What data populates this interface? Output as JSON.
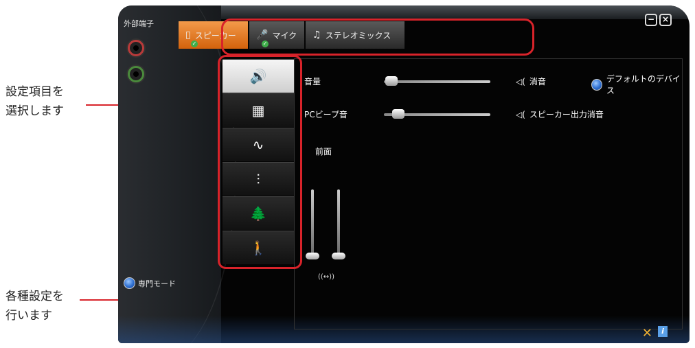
{
  "callouts": {
    "select_line1": "設定項目を",
    "select_line2": "選択します",
    "settings_line1": "各種設定を",
    "settings_line2": "行います"
  },
  "window": {
    "external_port_title": "外部端子",
    "expert_mode_label": "専門モード",
    "minimize_symbol": "−",
    "close_symbol": "×"
  },
  "tabs": [
    {
      "label": "スピーカー",
      "icon": "speaker-icon",
      "active": true,
      "has_check": true
    },
    {
      "label": "マイク",
      "icon": "microphone-icon",
      "active": false,
      "has_check": true
    },
    {
      "label": "ステレオミックス",
      "icon": "music-note-icon",
      "active": false,
      "has_check": false
    }
  ],
  "categories": [
    {
      "name": "volume-icon",
      "glyph": "🔊"
    },
    {
      "name": "speaker-config-icon",
      "glyph": "▦"
    },
    {
      "name": "waveform-icon",
      "glyph": "∿"
    },
    {
      "name": "equalizer-icon",
      "glyph": "⫶"
    },
    {
      "name": "environment-icon",
      "glyph": "🌲"
    },
    {
      "name": "room-correction-icon",
      "glyph": "🚶"
    }
  ],
  "main": {
    "volume_label": "音量",
    "volume_level": 0.04,
    "mute_label": "消音",
    "default_device_label": "デフォルトのデバイス",
    "pc_beep_label": "PCビープ音",
    "pc_beep_level": 0.1,
    "speaker_mute_label": "スピーカー出力消音",
    "front_label": "前面",
    "balance_symbol": "((↔))"
  },
  "colors": {
    "accent_red": "#d8232a",
    "tab_active_orange": "#e0711a",
    "radio_blue": "#2e6fd1",
    "check_green": "#3fae4a"
  }
}
